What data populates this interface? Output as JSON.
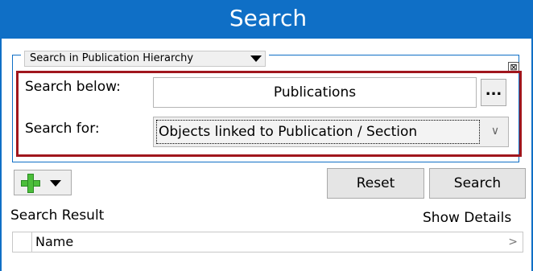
{
  "window": {
    "title": "Search"
  },
  "scope": {
    "selected": "Search in Publication Hierarchy",
    "close_glyph": "⊠"
  },
  "form": {
    "search_below_label": "Search below:",
    "search_below_value": "Publications",
    "browse_label": "...",
    "search_for_label": "Search for:",
    "search_for_value": "Objects linked to Publication / Section"
  },
  "toolbar": {
    "reset_label": "Reset",
    "search_label": "Search"
  },
  "results": {
    "title": "Search Result",
    "show_details_label": "Show Details",
    "columns": [
      "Name"
    ]
  },
  "icons": {
    "add": "plus-icon",
    "dropdown": "caret-down-icon",
    "chevron": "chevron-down-icon",
    "column_chevron": "chevron-right-icon"
  },
  "colors": {
    "accent": "#0f6fc6",
    "highlight": "#a0161d",
    "add_icon": "#4cbe3b"
  }
}
